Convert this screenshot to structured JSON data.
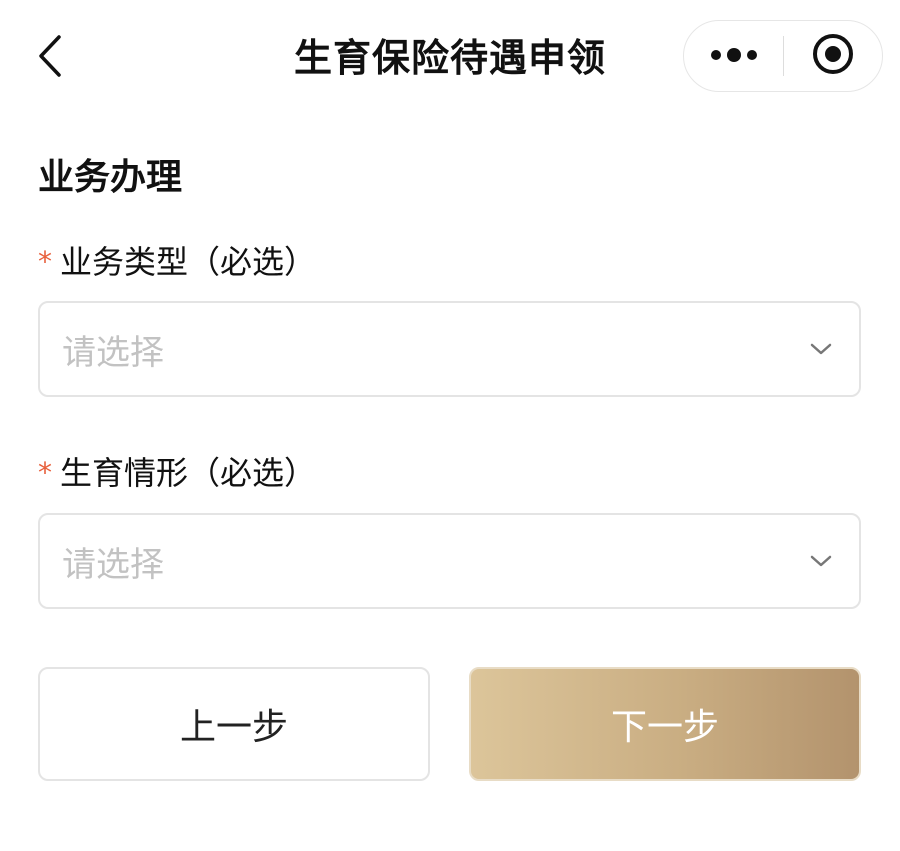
{
  "header": {
    "title": "生育保险待遇申领"
  },
  "section": {
    "title": "业务办理"
  },
  "fields": [
    {
      "required_mark": "*",
      "label": "业务类型（必选）",
      "placeholder": "请选择"
    },
    {
      "required_mark": "*",
      "label": "生育情形（必选）",
      "placeholder": "请选择"
    }
  ],
  "actions": {
    "prev_label": "上一步",
    "next_label": "下一步"
  },
  "icons": {
    "back": "chevron-left-icon",
    "more": "more-dots-icon",
    "close": "target-circle-icon",
    "dropdown": "chevron-down-icon"
  },
  "colors": {
    "required": "#e8603c",
    "placeholder": "#c2c2c2",
    "primary_gradient_start": "#dcc59a",
    "primary_gradient_end": "#b3936d"
  }
}
